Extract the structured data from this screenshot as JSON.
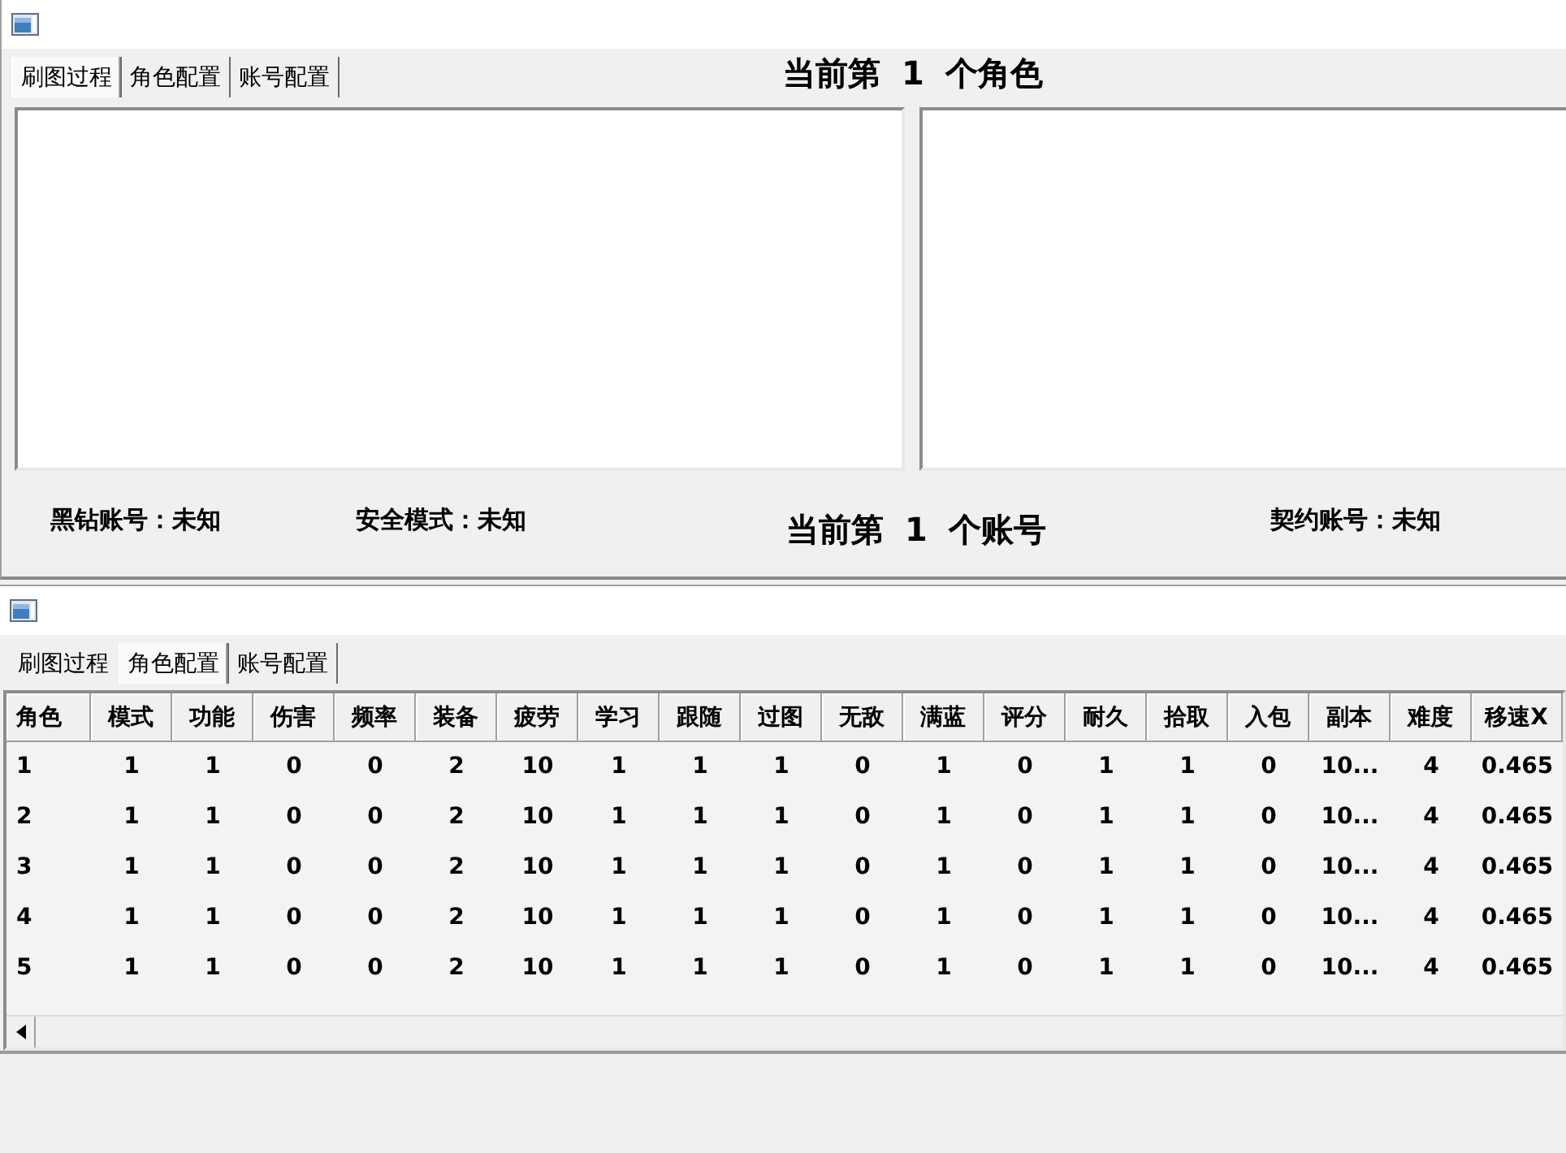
{
  "windows": [
    {
      "tabs": [
        {
          "label": "刷图过程",
          "selected": true
        },
        {
          "label": "角色配置",
          "selected": false
        },
        {
          "label": "账号配置",
          "selected": false
        }
      ],
      "heading": "当前第 1 个角色",
      "status_bar": [
        {
          "kind": "field",
          "text": "黑钻账号：未知"
        },
        {
          "kind": "field",
          "text": "安全模式：未知"
        },
        {
          "kind": "heading",
          "text": "当前第 1 个账号"
        },
        {
          "kind": "field",
          "text": "契约账号：未知"
        }
      ]
    },
    {
      "tabs": [
        {
          "label": "刷图过程",
          "selected": false
        },
        {
          "label": "角色配置",
          "selected": true
        },
        {
          "label": "账号配置",
          "selected": false
        }
      ],
      "table": {
        "columns": [
          "角色",
          "模式",
          "功能",
          "伤害",
          "频率",
          "装备",
          "疲劳",
          "学习",
          "跟随",
          "过图",
          "无敌",
          "满蓝",
          "评分",
          "耐久",
          "拾取",
          "入包",
          "副本",
          "难度",
          "移速X"
        ],
        "rows": [
          [
            "1",
            "1",
            "1",
            "0",
            "0",
            "2",
            "10",
            "1",
            "1",
            "1",
            "0",
            "1",
            "0",
            "1",
            "1",
            "0",
            "10...",
            "4",
            "0.465"
          ],
          [
            "2",
            "1",
            "1",
            "0",
            "0",
            "2",
            "10",
            "1",
            "1",
            "1",
            "0",
            "1",
            "0",
            "1",
            "1",
            "0",
            "10...",
            "4",
            "0.465"
          ],
          [
            "3",
            "1",
            "1",
            "0",
            "0",
            "2",
            "10",
            "1",
            "1",
            "1",
            "0",
            "1",
            "0",
            "1",
            "1",
            "0",
            "10...",
            "4",
            "0.465"
          ],
          [
            "4",
            "1",
            "1",
            "0",
            "0",
            "2",
            "10",
            "1",
            "1",
            "1",
            "0",
            "1",
            "0",
            "1",
            "1",
            "0",
            "10...",
            "4",
            "0.465"
          ],
          [
            "5",
            "1",
            "1",
            "0",
            "0",
            "2",
            "10",
            "1",
            "1",
            "1",
            "0",
            "1",
            "0",
            "1",
            "1",
            "0",
            "10...",
            "4",
            "0.465"
          ]
        ]
      }
    }
  ]
}
